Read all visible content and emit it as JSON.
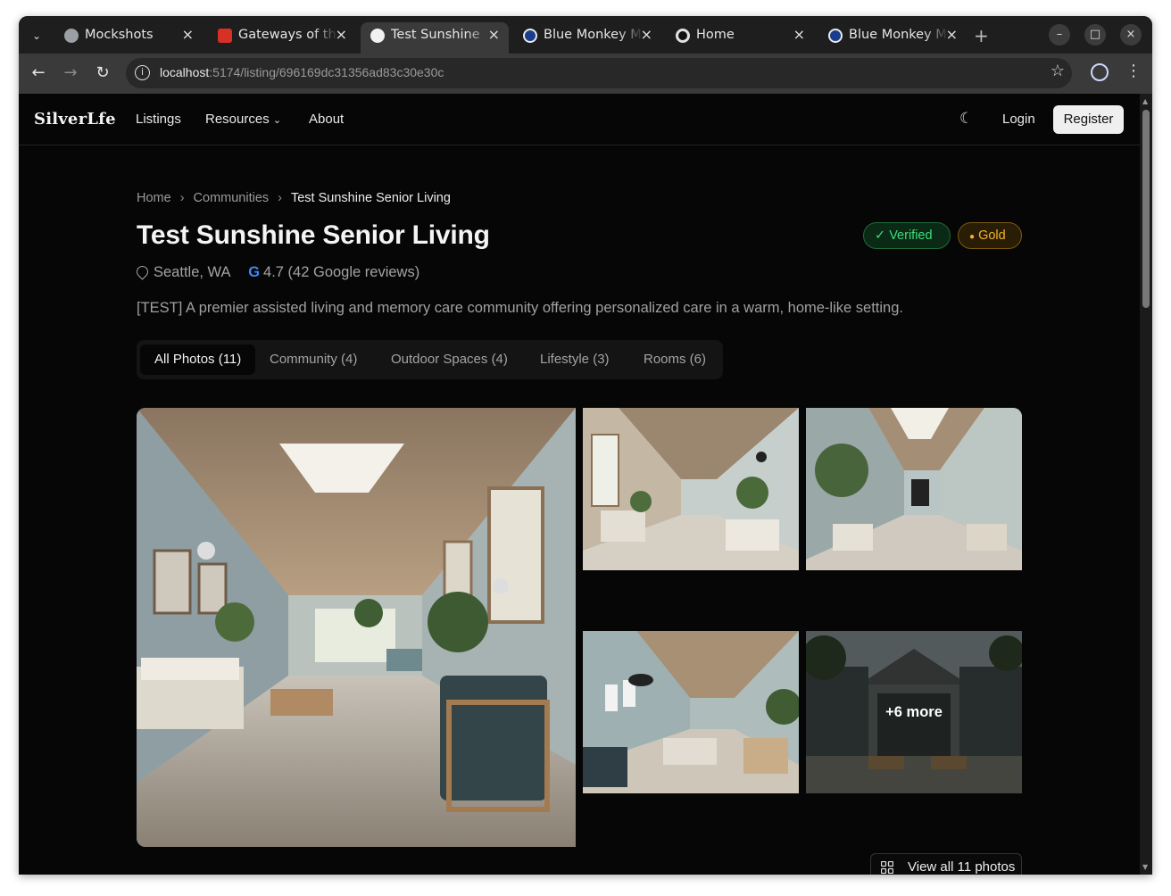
{
  "browser": {
    "tabs": [
      {
        "title": "Mockshots",
        "favicon_color": "#9aa0a6"
      },
      {
        "title": "Gateways of th",
        "favicon_color": "#d93025"
      },
      {
        "title": "Test Sunshine",
        "favicon_color": "#f1f1f1"
      },
      {
        "title": "Blue Monkey M",
        "favicon_color": "#1a3c8c"
      },
      {
        "title": "Home",
        "favicon_color": "#e0e0e0"
      },
      {
        "title": "Blue Monkey M",
        "favicon_color": "#1a3c8c"
      }
    ],
    "active_tab": 2,
    "url_host": "localhost",
    "url_path": ":5174/listing/696169dc31356ad83c30e30c"
  },
  "site": {
    "logo": "SilverLfe",
    "nav": {
      "listings": "Listings",
      "resources": "Resources",
      "about": "About"
    },
    "login": "Login",
    "register": "Register"
  },
  "breadcrumb": {
    "home": "Home",
    "communities": "Communities",
    "current": "Test Sunshine Senior Living"
  },
  "listing": {
    "title": "Test Sunshine Senior Living",
    "badges": {
      "verified": "Verified",
      "gold": "Gold"
    },
    "location": "Seattle, WA",
    "google_icon": "G",
    "rating": "4.7 (42 Google reviews)",
    "description": "[TEST] A premier assisted living and memory care community offering personalized care in a warm, home-like setting."
  },
  "photo_filters": [
    {
      "label": "All Photos (11)",
      "active": true
    },
    {
      "label": "Community (4)",
      "active": false
    },
    {
      "label": "Outdoor Spaces (4)",
      "active": false
    },
    {
      "label": "Lifestyle (3)",
      "active": false
    },
    {
      "label": "Rooms (6)",
      "active": false
    }
  ],
  "gallery": {
    "more_label": "+6 more",
    "view_all": "View all 11 photos"
  },
  "colors": {
    "verified": "#3ddc7a",
    "gold": "#f1b52a",
    "page_bg": "#060606"
  }
}
